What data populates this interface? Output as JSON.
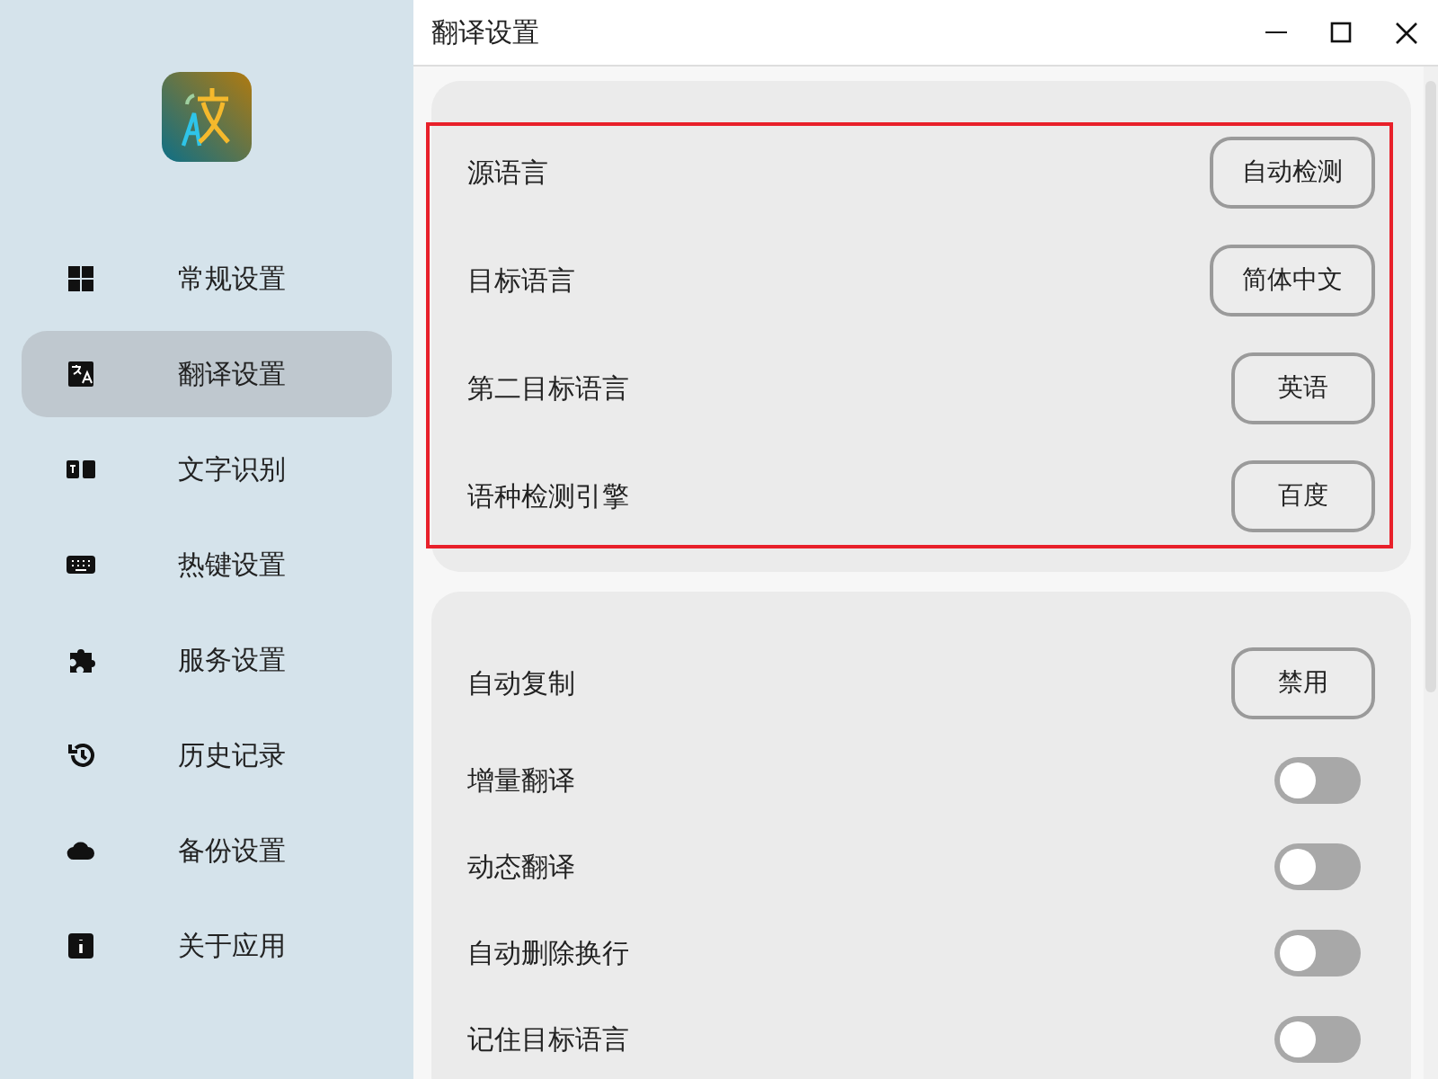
{
  "window": {
    "title": "翻译设置"
  },
  "sidebar": {
    "items": [
      {
        "label": "常规设置",
        "selected": false
      },
      {
        "label": "翻译设置",
        "selected": true
      },
      {
        "label": "文字识别",
        "selected": false
      },
      {
        "label": "热键设置",
        "selected": false
      },
      {
        "label": "服务设置",
        "selected": false
      },
      {
        "label": "历史记录",
        "selected": false
      },
      {
        "label": "备份设置",
        "selected": false
      },
      {
        "label": "关于应用",
        "selected": false
      }
    ]
  },
  "cards": [
    {
      "highlighted": true,
      "rows": [
        {
          "kind": "select",
          "label": "源语言",
          "value": "自动检测"
        },
        {
          "kind": "select",
          "label": "目标语言",
          "value": "简体中文"
        },
        {
          "kind": "select",
          "label": "第二目标语言",
          "value": "英语"
        },
        {
          "kind": "select",
          "label": "语种检测引擎",
          "value": "百度"
        }
      ]
    },
    {
      "highlighted": false,
      "rows": [
        {
          "kind": "select",
          "label": "自动复制",
          "value": "禁用"
        },
        {
          "kind": "toggle",
          "label": "增量翻译",
          "on": false
        },
        {
          "kind": "toggle",
          "label": "动态翻译",
          "on": false
        },
        {
          "kind": "toggle",
          "label": "自动删除换行",
          "on": false
        },
        {
          "kind": "toggle",
          "label": "记住目标语言",
          "on": false
        }
      ]
    }
  ]
}
